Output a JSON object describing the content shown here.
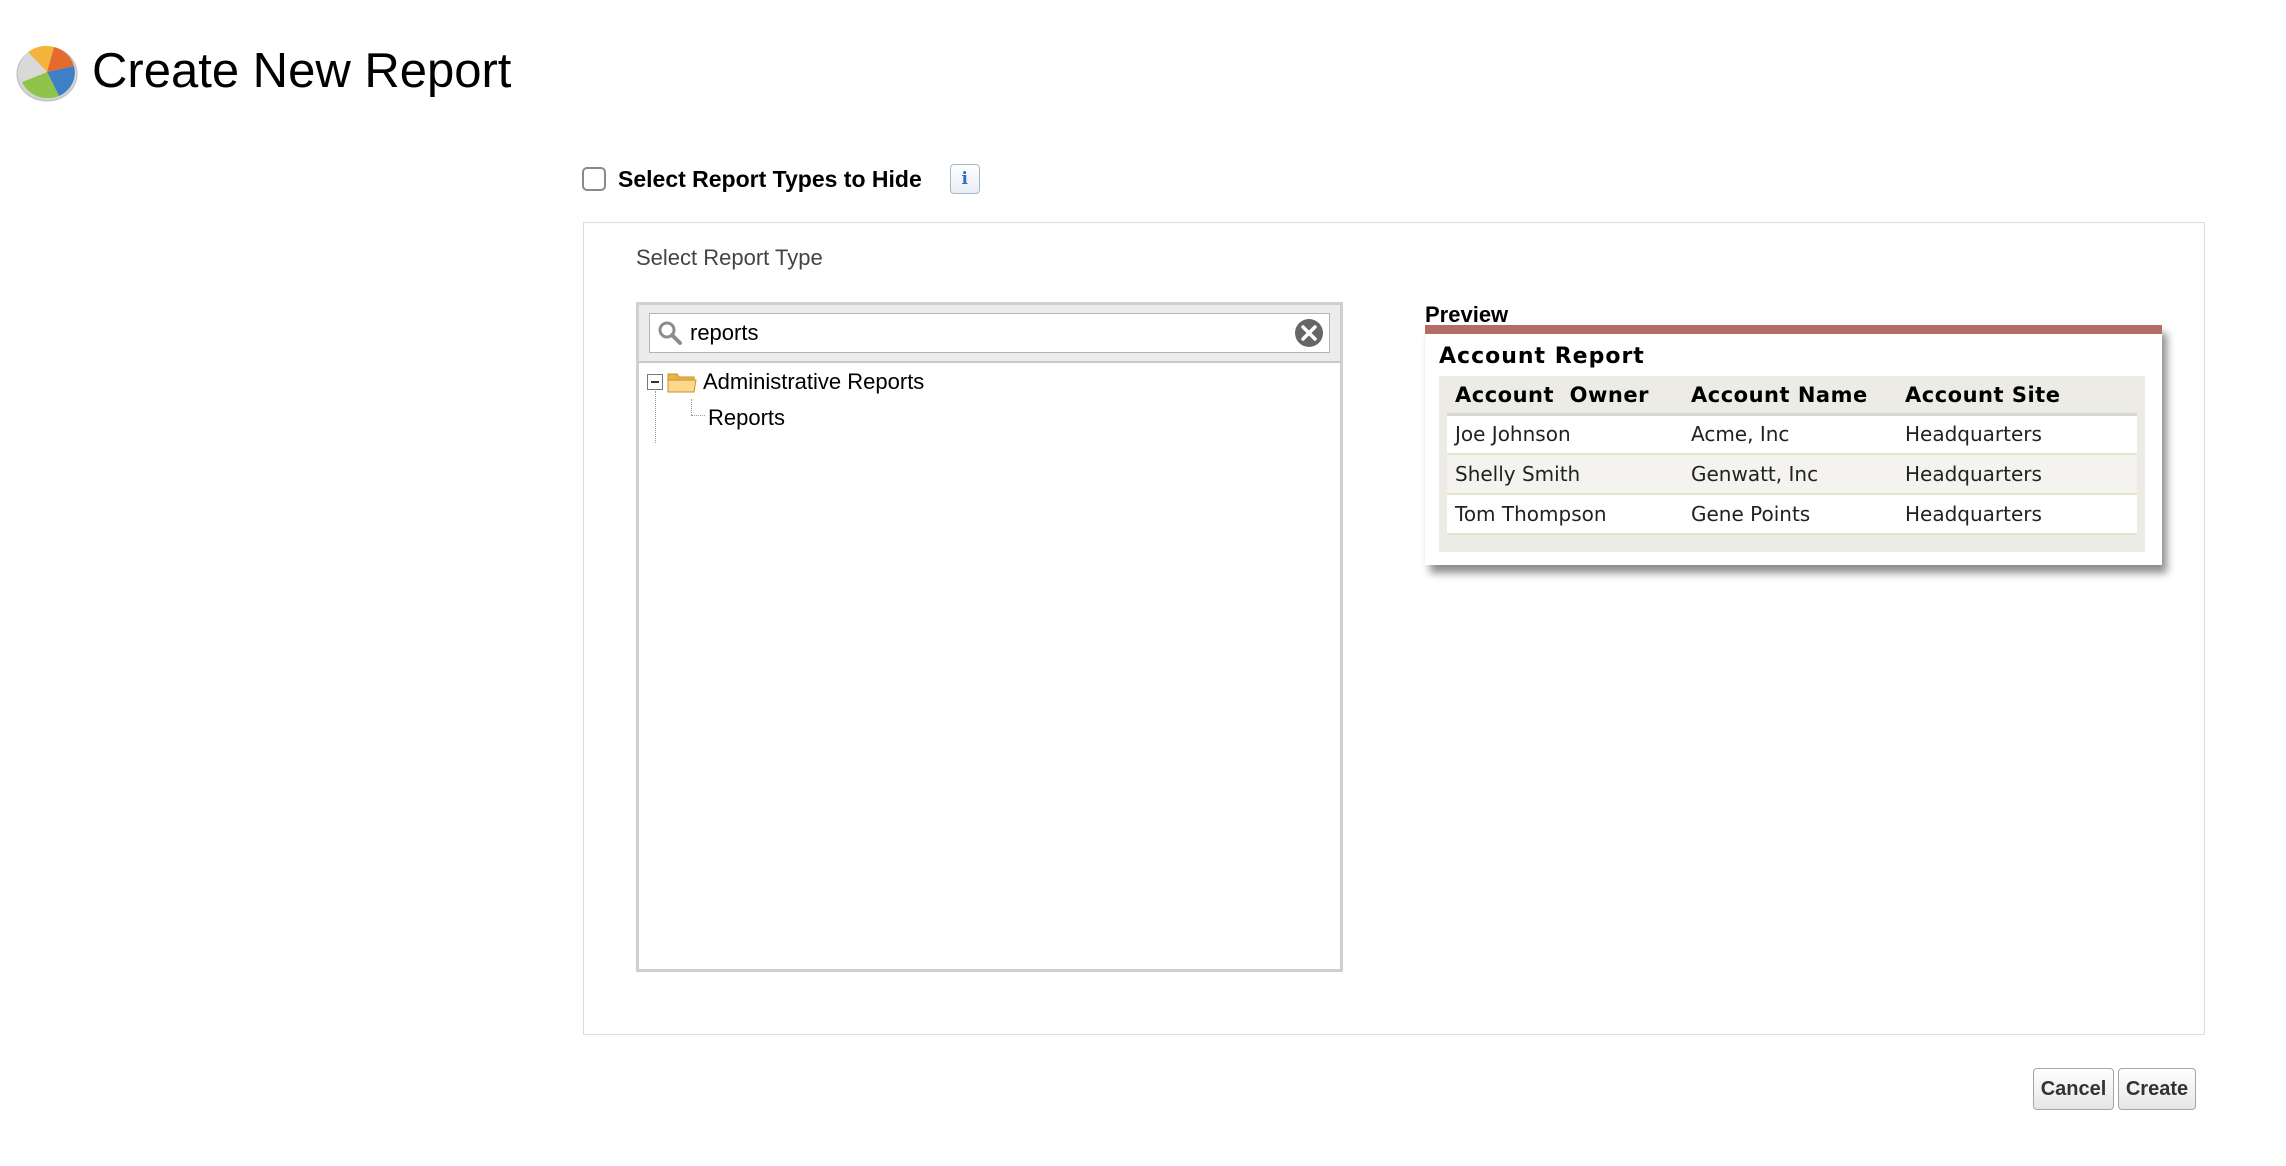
{
  "header": {
    "title": "Create New Report",
    "logo_icon": "pie-chart-icon"
  },
  "hide_toggle": {
    "label": "Select Report Types to Hide",
    "checked": false,
    "info_glyph": "i"
  },
  "report_type": {
    "section_label": "Select Report Type",
    "search": {
      "value": "reports",
      "icon": "search-icon",
      "clear_icon": "clear-icon"
    },
    "tree": {
      "folder": {
        "label": "Administrative Reports",
        "expanded": true,
        "icon": "folder-open-icon"
      },
      "items": [
        {
          "label": "Reports"
        }
      ]
    }
  },
  "preview": {
    "label": "Preview",
    "title": "Account Report",
    "accent_color": "#b36e63",
    "columns": [
      "Account  Owner",
      "Account Name",
      "Account Site"
    ],
    "rows": [
      [
        "Joe Johnson",
        "Acme, Inc",
        "Headquarters"
      ],
      [
        "Shelly Smith",
        "Genwatt, Inc",
        "Headquarters"
      ],
      [
        "Tom Thompson",
        "Gene Points",
        "Headquarters"
      ]
    ]
  },
  "actions": {
    "cancel_label": "Cancel",
    "create_label": "Create"
  }
}
